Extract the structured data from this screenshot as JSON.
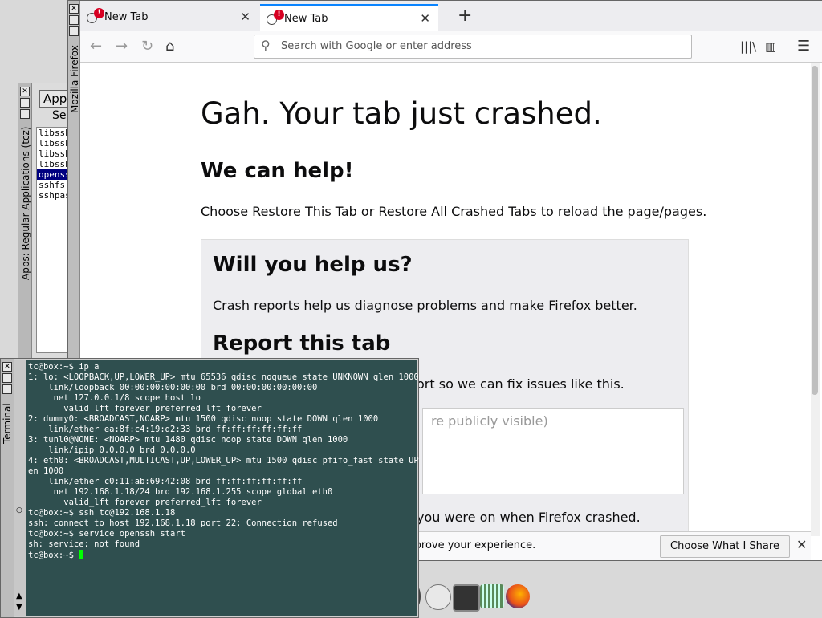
{
  "apps_window": {
    "title": "Apps: Regular Applications (tcz)",
    "apps_button": "Apps",
    "select_label": "Sel",
    "items": [
      {
        "label": "libssh",
        "selected": false
      },
      {
        "label": "libssh",
        "selected": false
      },
      {
        "label": "libssh",
        "selected": false
      },
      {
        "label": "libssh",
        "selected": false
      },
      {
        "label": "openss",
        "selected": true
      },
      {
        "label": "sshfs.",
        "selected": false
      },
      {
        "label": "sshpas",
        "selected": false
      }
    ]
  },
  "firefox": {
    "window_title": "Mozilla Firefox",
    "tabs": [
      {
        "label": "New Tab",
        "badge": "!"
      },
      {
        "label": "New Tab",
        "badge": "!"
      }
    ],
    "new_tab_symbol": "+",
    "url_placeholder": "Search with Google or enter address",
    "content": {
      "heading": "Gah. Your tab just crashed.",
      "help_heading": "We can help!",
      "help_text": "Choose Restore This Tab or Restore All Crashed Tabs to reload the page/pages.",
      "will_you_heading": "Will you help us?",
      "will_you_text": "Crash reports help us diagnose problems and make Firefox better.",
      "report_heading": "Report this tab",
      "report_partial": "ort so we can fix issues like this.",
      "comment_placeholder_partial": "re publicly visible)",
      "url_partial": "you were on when Firefox crashed."
    },
    "notification": {
      "text": "mprove your experience.",
      "button": "Choose What I Share",
      "close": "✕"
    }
  },
  "terminal": {
    "title": "Terminal",
    "lines": [
      "tc@box:~$ ip a",
      "1: lo: <LOOPBACK,UP,LOWER_UP> mtu 65536 qdisc noqueue state UNKNOWN qlen 1000",
      "    link/loopback 00:00:00:00:00:00 brd 00:00:00:00:00:00",
      "    inet 127.0.0.1/8 scope host lo",
      "       valid_lft forever preferred_lft forever",
      "2: dummy0: <BROADCAST,NOARP> mtu 1500 qdisc noop state DOWN qlen 1000",
      "    link/ether ea:8f:c4:19:d2:33 brd ff:ff:ff:ff:ff:ff",
      "3: tunl0@NONE: <NOARP> mtu 1480 qdisc noop state DOWN qlen 1000",
      "    link/ipip 0.0.0.0 brd 0.0.0.0",
      "4: eth0: <BROADCAST,MULTICAST,UP,LOWER_UP> mtu 1500 qdisc pfifo_fast state UP ql",
      "en 1000",
      "    link/ether c0:11:ab:69:42:08 brd ff:ff:ff:ff:ff:ff",
      "    inet 192.168.1.18/24 brd 192.168.1.255 scope global eth0",
      "       valid_lft forever preferred_lft forever",
      "tc@box:~$ ssh tc@192.168.1.18",
      "ssh: connect to host 192.168.1.18 port 22: Connection refused",
      "tc@box:~$ service openssh start",
      "sh: service: not found"
    ],
    "prompt": "tc@box:~$ "
  },
  "colors": {
    "terminal_bg": "#2f4f4f",
    "tab_accent": "#0a84ff",
    "badge": "#d70022",
    "cursor": "#00ff00"
  }
}
